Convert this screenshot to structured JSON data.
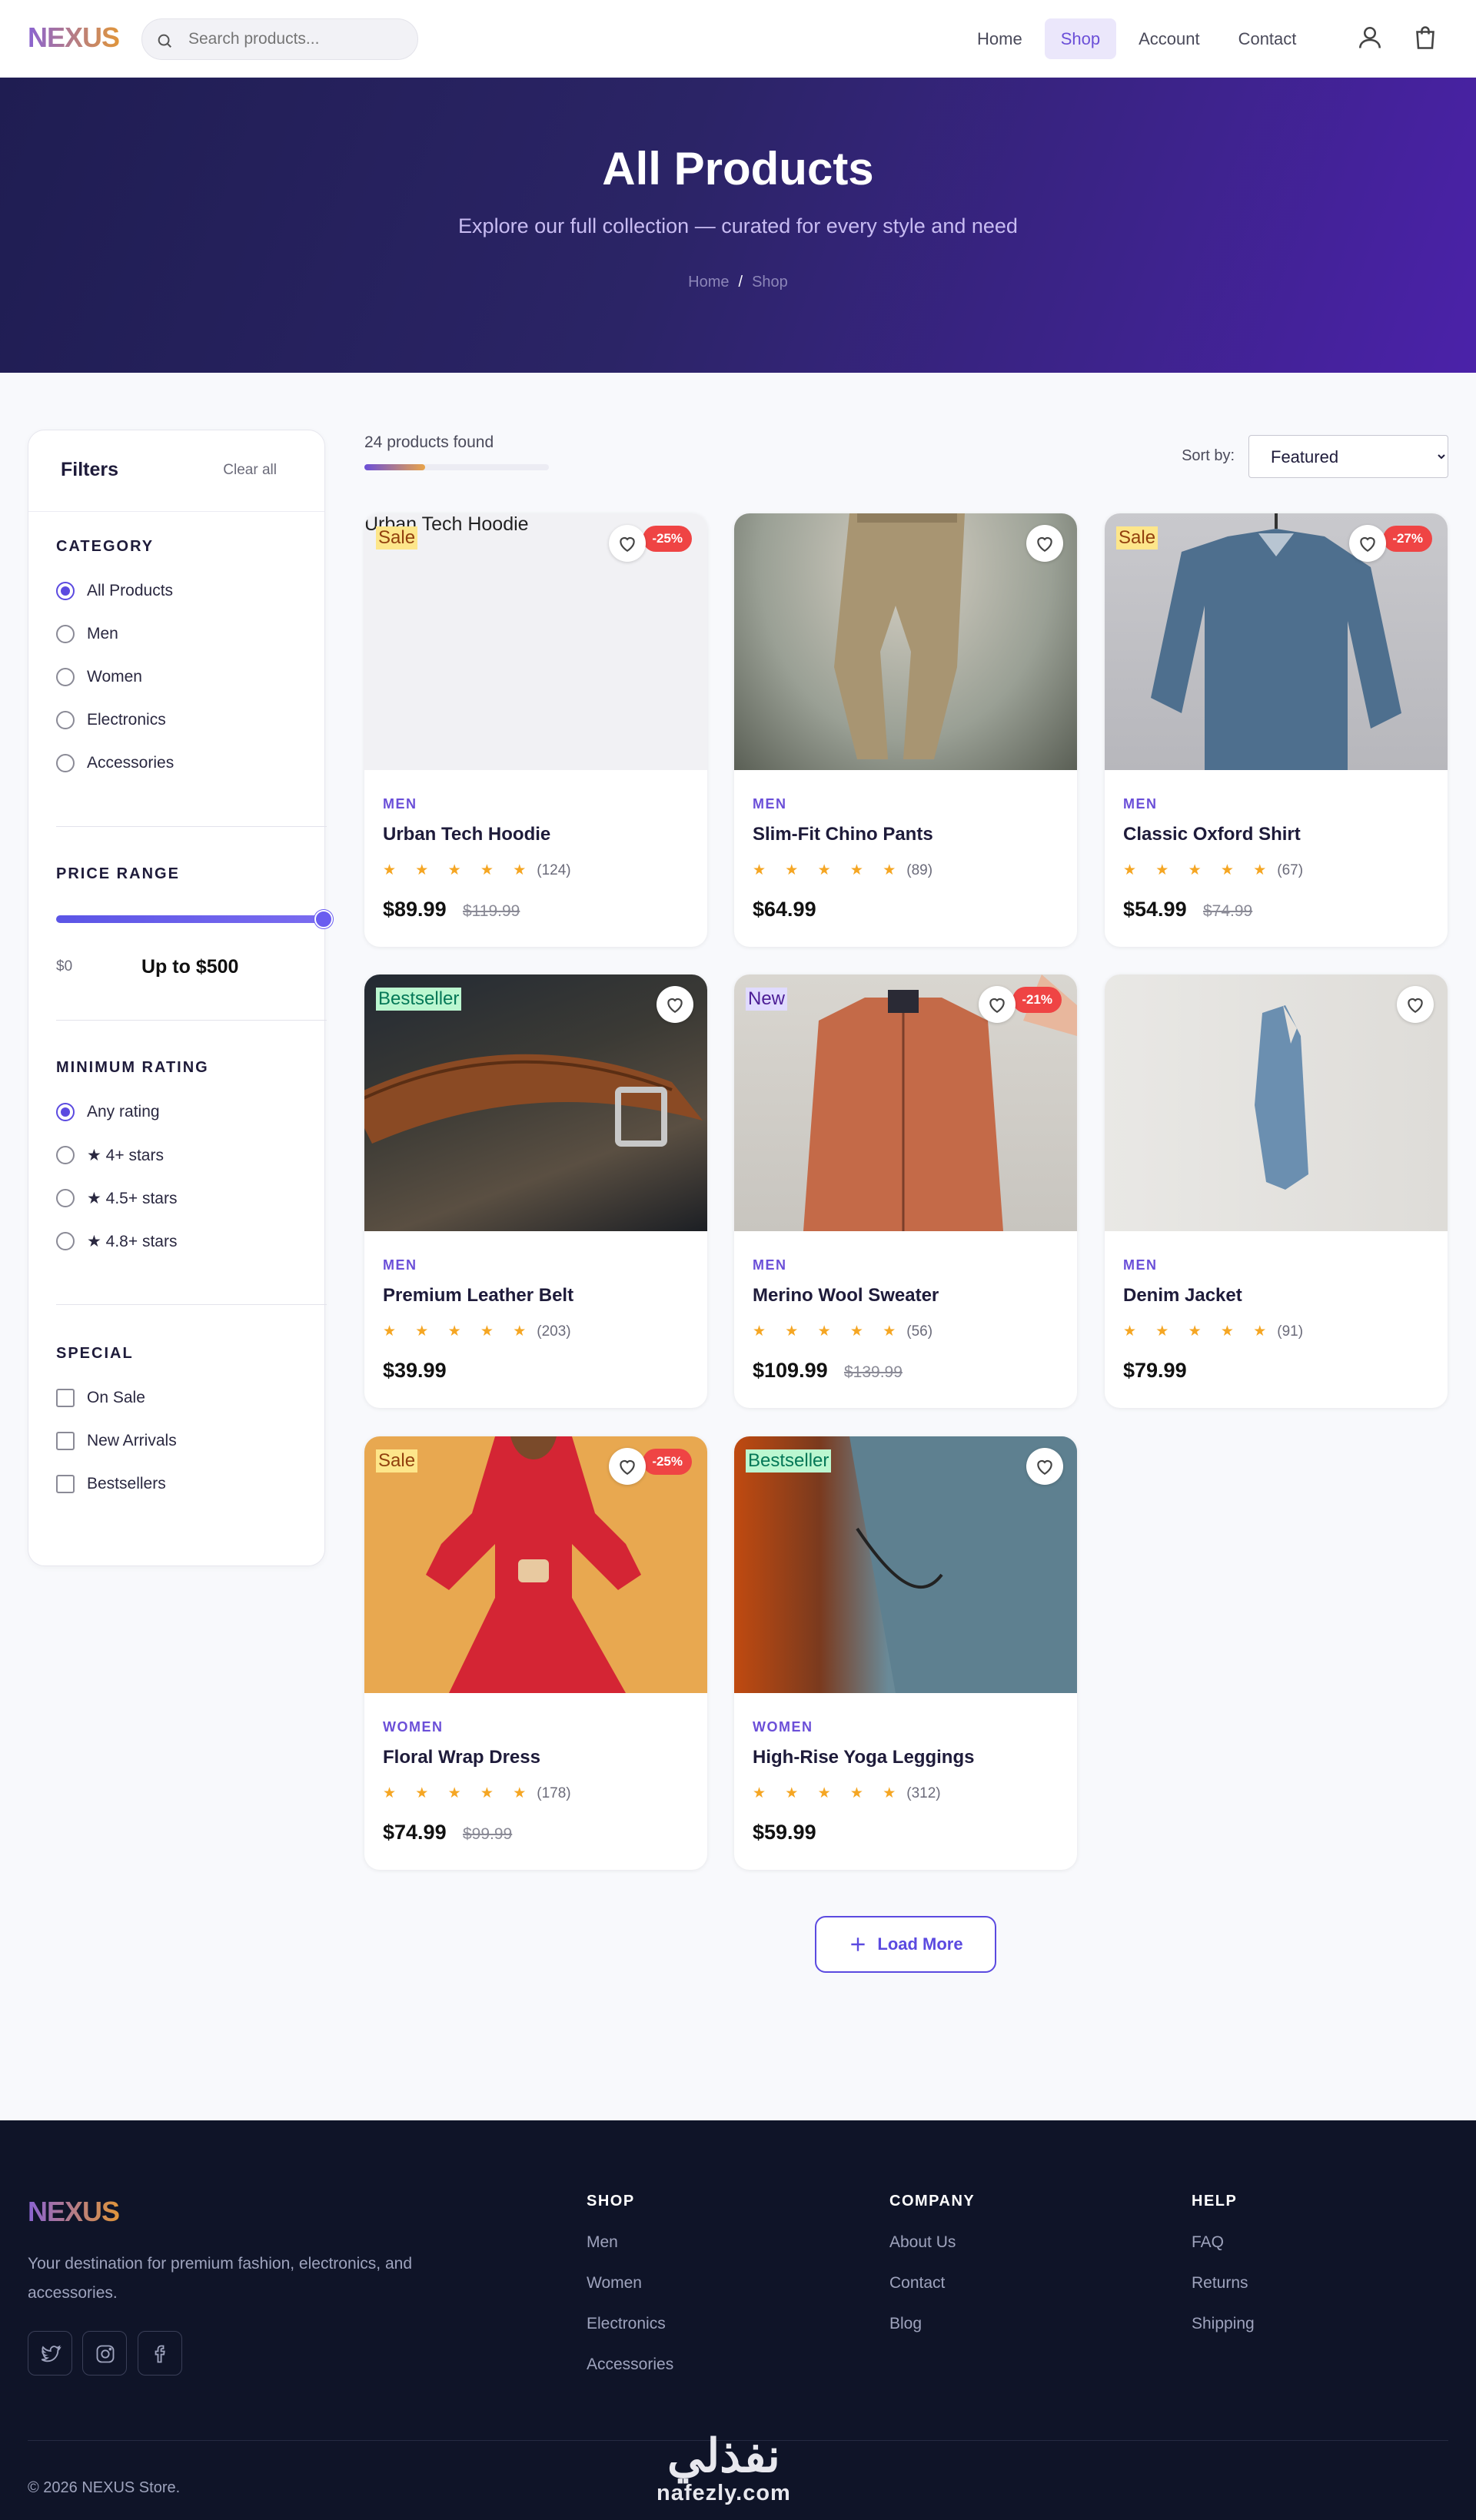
{
  "brand": {
    "name": "NEXUS",
    "accent": "#6b4fd8",
    "gradient": [
      "#8a63d2",
      "#e0953a"
    ]
  },
  "search": {
    "placeholder": "Search products..."
  },
  "nav": {
    "links": [
      "Home",
      "Shop",
      "Account",
      "Contact"
    ],
    "active": "Shop",
    "icons": [
      "user-icon",
      "shopping-bag-icon"
    ]
  },
  "hero": {
    "title": "All Products",
    "subtitle": "Explore our full collection — curated for every style and need",
    "crumbs": [
      "Home",
      "Shop"
    ]
  },
  "filters": {
    "title": "Filters",
    "clear": "Clear all",
    "category": {
      "heading": "CATEGORY",
      "options": [
        "All Products",
        "Men",
        "Women",
        "Electronics",
        "Accessories"
      ],
      "selected": "All Products"
    },
    "price": {
      "heading": "PRICE RANGE",
      "min": "$0",
      "max_label": "Up to $500",
      "value_fraction": 1.0
    },
    "rating": {
      "heading": "MINIMUM RATING",
      "options": [
        "Any rating",
        "★ 4+ stars",
        "★ 4.5+ stars",
        "★ 4.8+ stars"
      ],
      "selected": "Any rating"
    },
    "special": {
      "heading": "SPECIAL",
      "options": [
        "On Sale",
        "New Arrivals",
        "Bestsellers"
      ]
    }
  },
  "results": {
    "count_text": "24 products found",
    "progress_fraction": 0.33,
    "sort_label": "Sort by:",
    "sort_value": "Featured"
  },
  "products": [
    {
      "name": "Urban Tech Hoodie",
      "category": "MEN",
      "reviews": "(124)",
      "rating": 4.5,
      "price": "$89.99",
      "old_price": "$119.99",
      "badge": "Sale",
      "discount": "-25%",
      "image_alt": "Urban Tech Hoodie",
      "image_broken": true
    },
    {
      "name": "Slim-Fit Chino Pants",
      "category": "MEN",
      "reviews": "(89)",
      "rating": 4.5,
      "price": "$64.99",
      "old_price": "",
      "badge": "",
      "discount": ""
    },
    {
      "name": "Classic Oxford Shirt",
      "category": "MEN",
      "reviews": "(67)",
      "rating": 4.5,
      "price": "$54.99",
      "old_price": "$74.99",
      "badge": "Sale",
      "discount": "-27%"
    },
    {
      "name": "Premium Leather Belt",
      "category": "MEN",
      "reviews": "(203)",
      "rating": 4.5,
      "price": "$39.99",
      "old_price": "",
      "badge": "Bestseller",
      "discount": ""
    },
    {
      "name": "Merino Wool Sweater",
      "category": "MEN",
      "reviews": "(56)",
      "rating": 4.5,
      "price": "$109.99",
      "old_price": "$139.99",
      "badge": "New",
      "discount": "-21%"
    },
    {
      "name": "Denim Jacket",
      "category": "MEN",
      "reviews": "(91)",
      "rating": 4.5,
      "price": "$79.99",
      "old_price": "",
      "badge": "",
      "discount": ""
    },
    {
      "name": "Floral Wrap Dress",
      "category": "WOMEN",
      "reviews": "(178)",
      "rating": 4.5,
      "price": "$74.99",
      "old_price": "$99.99",
      "badge": "Sale",
      "discount": "-25%"
    },
    {
      "name": "High-Rise Yoga Leggings",
      "category": "WOMEN",
      "reviews": "(312)",
      "rating": 4.5,
      "price": "$59.99",
      "old_price": "",
      "badge": "Bestseller",
      "discount": ""
    }
  ],
  "stars_glyph": "★ ★ ★ ★ ★",
  "load_more": "Load More",
  "footer": {
    "brand": "NEXUS",
    "description": "Your destination for premium fashion, electronics, and accessories.",
    "social": [
      "twitter-icon",
      "instagram-icon",
      "facebook-icon"
    ],
    "columns": [
      {
        "heading": "SHOP",
        "links": [
          "Men",
          "Women",
          "Electronics",
          "Accessories"
        ]
      },
      {
        "heading": "COMPANY",
        "links": [
          "About Us",
          "Contact",
          "Blog"
        ]
      },
      {
        "heading": "HELP",
        "links": [
          "FAQ",
          "Returns",
          "Shipping"
        ]
      }
    ],
    "copyright": "© 2026 NEXUS Store."
  },
  "watermark": {
    "arabic": "نفذلي",
    "latin": "nafezly.com"
  }
}
